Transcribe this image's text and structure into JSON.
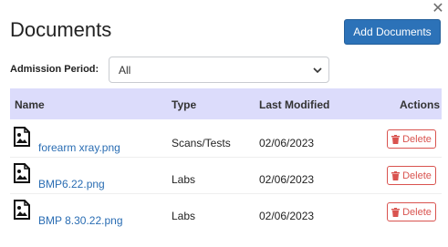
{
  "modal": {
    "title": "Documents",
    "add_button": "Add Documents",
    "close_icon": "close-icon"
  },
  "filter": {
    "label": "Admission Period:",
    "selected": "All"
  },
  "table": {
    "headers": {
      "name": "Name",
      "type": "Type",
      "modified": "Last Modified",
      "actions": "Actions"
    },
    "rows": [
      {
        "name": "forearm xray.png",
        "type": "Scans/Tests",
        "modified": "02/06/2023",
        "action": "Delete"
      },
      {
        "name": "BMP6.22.png",
        "type": "Labs",
        "modified": "02/06/2023",
        "action": "Delete"
      },
      {
        "name": "BMP 8.30.22.png",
        "type": "Labs",
        "modified": "02/06/2023",
        "action": "Delete"
      }
    ]
  },
  "colors": {
    "primary": "#2c72b8",
    "header_bg": "#dcdcfb",
    "danger": "#d9534f",
    "link": "#2a6db3"
  }
}
